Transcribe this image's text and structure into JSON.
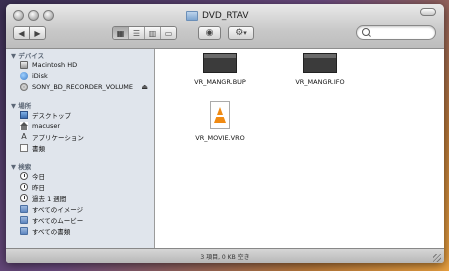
{
  "window": {
    "title": "DVD_RTAV"
  },
  "toolbar": {
    "back_icon": "◀",
    "forward_icon": "▶",
    "view_modes": [
      "icon-view",
      "list-view",
      "column-view",
      "coverflow-view"
    ],
    "quicklook_icon": "eye-icon",
    "action_icon": "gear-icon",
    "action_arrow": "▾",
    "search_placeholder": ""
  },
  "sidebar": {
    "devices_header": "▼ デバイス",
    "devices": [
      {
        "label": "Macintosh HD",
        "icon": "disk-icon"
      },
      {
        "label": "iDisk",
        "icon": "idisk-icon"
      },
      {
        "label": "SONY_BD_RECORDER_VOLUME",
        "icon": "disc-icon",
        "eject": "⏏"
      }
    ],
    "places_header": "▼ 場所",
    "places": [
      {
        "label": "デスクトップ",
        "icon": "desktop-icon"
      },
      {
        "label": "macuser",
        "icon": "home-icon"
      },
      {
        "label": "アプリケーション",
        "icon": "applications-icon"
      },
      {
        "label": "書類",
        "icon": "documents-icon"
      }
    ],
    "search_header": "▼ 検索",
    "searches": [
      {
        "label": "今日",
        "icon": "clock-icon"
      },
      {
        "label": "昨日",
        "icon": "clock-icon"
      },
      {
        "label": "過去 1 週間",
        "icon": "clock-icon"
      },
      {
        "label": "すべてのイメージ",
        "icon": "folder-icon"
      },
      {
        "label": "すべてのムービー",
        "icon": "folder-icon"
      },
      {
        "label": "すべての書類",
        "icon": "folder-icon"
      }
    ]
  },
  "files": [
    {
      "name": "VR_MANGR.BUP",
      "icon": "file-thumbnail-icon"
    },
    {
      "name": "VR_MANGR.IFO",
      "icon": "file-thumbnail-icon"
    },
    {
      "name": "VR_MOVIE.VRO",
      "icon": "vlc-file-icon"
    }
  ],
  "status": {
    "text": "3 項目, 0 KB 空き"
  }
}
